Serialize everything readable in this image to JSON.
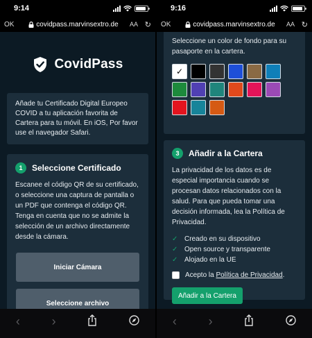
{
  "left": {
    "status_time": "9:14",
    "url_left": "OK",
    "url": "covidpass.marvinsextro.de",
    "aa": "AA",
    "logo_title": "CovidPass",
    "intro": "Añade tu Certificado Digital Europeo COVID a tu aplicación favorita de Cartera para tu móvil. En iOS, Por favor use el navegador Safari.",
    "step_number": "1",
    "step_title": "Seleccione Certificado",
    "step_text": "Escanee el código QR de su certificado, o seleccione una captura de pantalla o un PDF que contenga el código QR. Tenga en cuenta que no se admite la selección de un archivo directamente desde la cámara.",
    "btn_camera": "Iniciar Cámara",
    "btn_select": "Seleccione archivo"
  },
  "right": {
    "status_time": "9:16",
    "url_left": "OK",
    "url": "covidpass.marvinsextro.de",
    "aa": "AA",
    "color_text": "Seleccione un color de fondo para su pasaporte en la cartera.",
    "swatch_selected_mark": "✓",
    "step_number": "3",
    "step_title": "Añadir a la Cartera",
    "privacy_text": "La privacidad de los datos es de especial importancia cuando se procesan datos relacionados con la salud. Para que pueda tomar una decisión informada, lea la Política de Privacidad.",
    "checks": [
      "Creado en su dispositivo",
      "Open source y transparente",
      "Alojado en la UE"
    ],
    "consent_prefix": "Acepto la ",
    "consent_link": "Política de Privacidad",
    "consent_suffix": ".",
    "add_button": "Añadir a la Cartera"
  },
  "colors": {
    "accent": "#14a06c",
    "page_bg": "#0c1a24",
    "card_bg": "#1c2e3b",
    "button_gray": "#4f5e6b",
    "swatches": [
      "#ffffff",
      "#000000",
      "#333333",
      "#1e4fd8",
      "#8a6a44",
      "#0f7fb8",
      "#1d8a3c",
      "#5040b3",
      "#1f857c",
      "#e0491c",
      "#e31459",
      "#9b4ab5",
      "#e3141f",
      "#17849a",
      "#d55a14"
    ]
  },
  "icons": {
    "shield": "shield-check-icon",
    "lock": "lock-icon",
    "reload": "reload-icon",
    "back": "chevron-left-icon",
    "forward": "chevron-right-icon",
    "share": "share-icon",
    "compass": "compass-icon"
  }
}
